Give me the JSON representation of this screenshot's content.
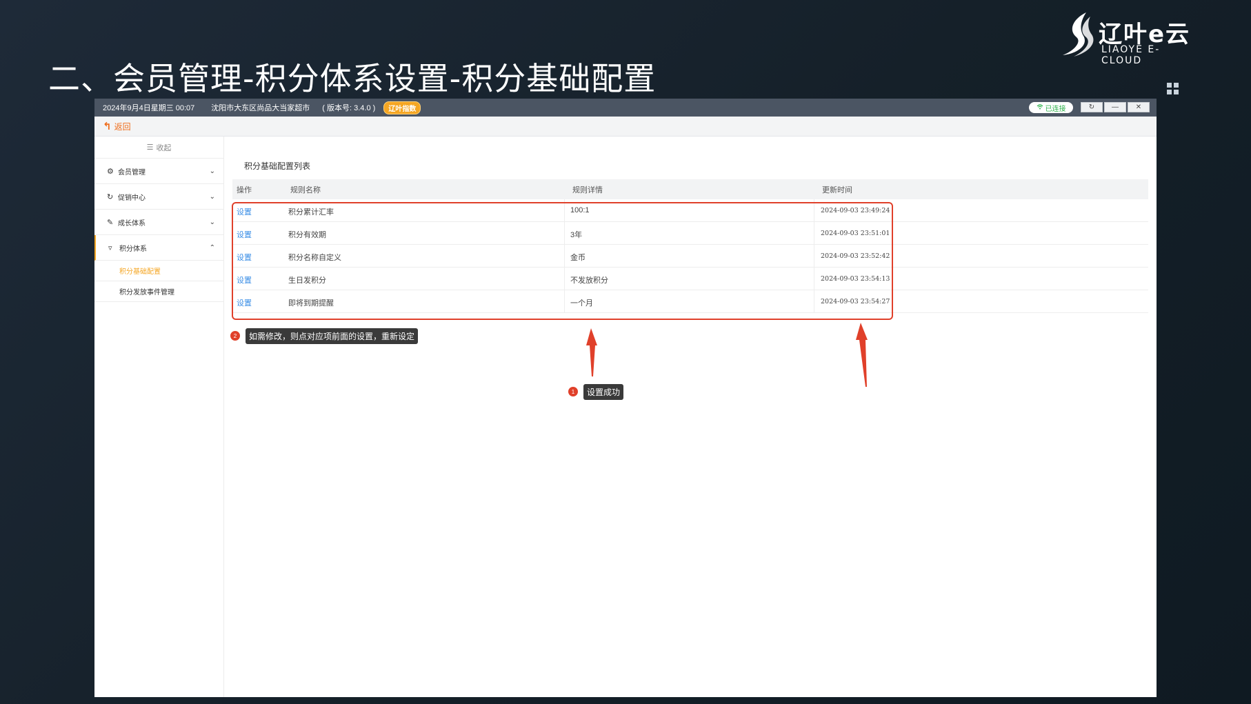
{
  "slide": {
    "title": "二、会员管理-积分体系设置-积分基础配置",
    "logo_cn": "辽叶e云",
    "logo_en": "LIAOYE E-CLOUD"
  },
  "topbar": {
    "datetime": "2024年9月4日星期三 00:07",
    "store": "沈阳市大东区尚品大当家超市",
    "version": "( 版本号: 3.4.0 )",
    "badge": "辽叶指数",
    "connection": "已连接",
    "refresh_icon": "refresh-icon",
    "minimize_icon": "minimize-icon",
    "close_icon": "close-icon"
  },
  "backbar": {
    "label": "返回"
  },
  "sidebar": {
    "collapse_label": "收起",
    "items": [
      {
        "label": "会员管理",
        "icon": "gear-icon",
        "expanded": false
      },
      {
        "label": "促销中心",
        "icon": "refresh-icon",
        "expanded": false
      },
      {
        "label": "成长体系",
        "icon": "growth-icon",
        "expanded": false
      },
      {
        "label": "积分体系",
        "icon": "filter-icon",
        "expanded": true
      }
    ],
    "sub_items": [
      {
        "label": "积分基础配置",
        "active": true
      },
      {
        "label": "积分发放事件管理",
        "active": false
      }
    ]
  },
  "main": {
    "list_title": "积分基础配置列表",
    "columns": [
      "操作",
      "规则名称",
      "规则详情",
      "更新时间"
    ],
    "rows": [
      {
        "op": "设置",
        "name": "积分累计汇率",
        "detail": "100:1",
        "time": "2024-09-03 23:49:24"
      },
      {
        "op": "设置",
        "name": "积分有效期",
        "detail": "3年",
        "time": "2024-09-03 23:51:01"
      },
      {
        "op": "设置",
        "name": "积分名称自定义",
        "detail": "金币",
        "time": "2024-09-03 23:52:42"
      },
      {
        "op": "设置",
        "name": "生日发积分",
        "detail": "不发放积分",
        "time": "2024-09-03 23:54:13"
      },
      {
        "op": "设置",
        "name": "即将到期提醒",
        "detail": "一个月",
        "time": "2024-09-03 23:54:27"
      }
    ]
  },
  "annotations": {
    "tip2_num": "2",
    "tip2": "如需修改，则点对应项前面的设置，重新设定",
    "tip1_num": "1",
    "tip1": "设置成功",
    "accent_color": "#e0402a"
  }
}
